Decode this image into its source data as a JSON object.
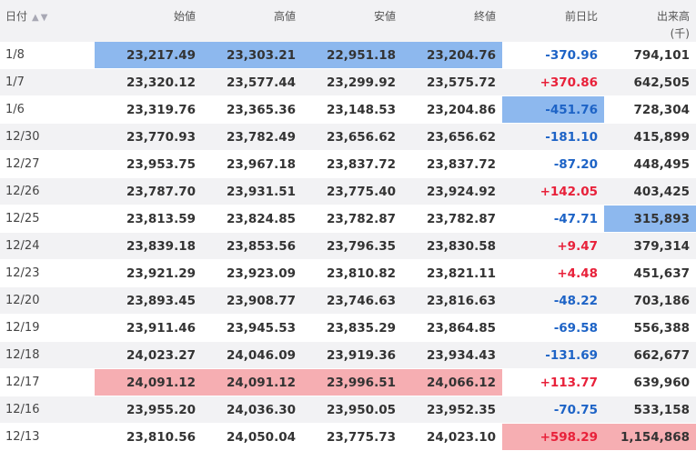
{
  "headers": {
    "date": "日付",
    "open": "始値",
    "high": "高値",
    "low": "安値",
    "close": "終値",
    "change": "前日比",
    "volume": "出来高",
    "volume_unit": "(千)"
  },
  "rows": [
    {
      "date": "1/8",
      "open": "23,217.49",
      "high": "23,303.21",
      "low": "22,951.18",
      "close": "23,204.76",
      "change": "-370.96",
      "volume": "794,101"
    },
    {
      "date": "1/7",
      "open": "23,320.12",
      "high": "23,577.44",
      "low": "23,299.92",
      "close": "23,575.72",
      "change": "+370.86",
      "volume": "642,505"
    },
    {
      "date": "1/6",
      "open": "23,319.76",
      "high": "23,365.36",
      "low": "23,148.53",
      "close": "23,204.86",
      "change": "-451.76",
      "volume": "728,304"
    },
    {
      "date": "12/30",
      "open": "23,770.93",
      "high": "23,782.49",
      "low": "23,656.62",
      "close": "23,656.62",
      "change": "-181.10",
      "volume": "415,899"
    },
    {
      "date": "12/27",
      "open": "23,953.75",
      "high": "23,967.18",
      "low": "23,837.72",
      "close": "23,837.72",
      "change": "-87.20",
      "volume": "448,495"
    },
    {
      "date": "12/26",
      "open": "23,787.70",
      "high": "23,931.51",
      "low": "23,775.40",
      "close": "23,924.92",
      "change": "+142.05",
      "volume": "403,425"
    },
    {
      "date": "12/25",
      "open": "23,813.59",
      "high": "23,824.85",
      "low": "23,782.87",
      "close": "23,782.87",
      "change": "-47.71",
      "volume": "315,893"
    },
    {
      "date": "12/24",
      "open": "23,839.18",
      "high": "23,853.56",
      "low": "23,796.35",
      "close": "23,830.58",
      "change": "+9.47",
      "volume": "379,314"
    },
    {
      "date": "12/23",
      "open": "23,921.29",
      "high": "23,923.09",
      "low": "23,810.82",
      "close": "23,821.11",
      "change": "+4.48",
      "volume": "451,637"
    },
    {
      "date": "12/20",
      "open": "23,893.45",
      "high": "23,908.77",
      "low": "23,746.63",
      "close": "23,816.63",
      "change": "-48.22",
      "volume": "703,186"
    },
    {
      "date": "12/19",
      "open": "23,911.46",
      "high": "23,945.53",
      "low": "23,835.29",
      "close": "23,864.85",
      "change": "-69.58",
      "volume": "556,388"
    },
    {
      "date": "12/18",
      "open": "24,023.27",
      "high": "24,046.09",
      "low": "23,919.36",
      "close": "23,934.43",
      "change": "-131.69",
      "volume": "662,677"
    },
    {
      "date": "12/17",
      "open": "24,091.12",
      "high": "24,091.12",
      "low": "23,996.51",
      "close": "24,066.12",
      "change": "+113.77",
      "volume": "639,960"
    },
    {
      "date": "12/16",
      "open": "23,955.20",
      "high": "24,036.30",
      "low": "23,950.05",
      "close": "23,952.35",
      "change": "-70.75",
      "volume": "533,158"
    },
    {
      "date": "12/13",
      "open": "23,810.56",
      "high": "24,050.04",
      "low": "23,775.73",
      "close": "24,023.10",
      "change": "+598.29",
      "volume": "1,154,868"
    }
  ],
  "colors": {
    "up": "#e8213a",
    "down": "#1d63c6",
    "highlight_low": "#8db8ee",
    "highlight_high": "#f6aeb2"
  },
  "icons": {
    "sort": [
      "sort-asc-icon",
      "sort-desc-icon"
    ]
  }
}
